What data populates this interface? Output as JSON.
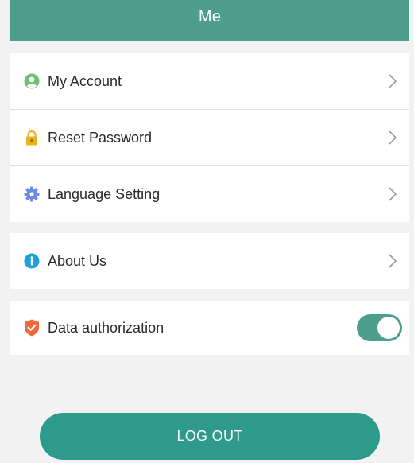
{
  "header": {
    "title": "Me"
  },
  "menu": {
    "account": {
      "label": "My Account",
      "icon": "user-icon"
    },
    "reset_password": {
      "label": "Reset Password",
      "icon": "lock-icon"
    },
    "language": {
      "label": "Language Setting",
      "icon": "gear-icon"
    },
    "about": {
      "label": "About Us",
      "icon": "info-icon"
    },
    "data_authorization": {
      "label": "Data authorization",
      "icon": "shield-icon",
      "enabled": true
    }
  },
  "logout": {
    "label": "LOG OUT"
  },
  "colors": {
    "header": "#4e9e8e",
    "toggle_on": "#4e9e8e",
    "logout_button": "#2e9a8b",
    "account_icon": "#6cc26d",
    "lock_icon": "#e8b41e",
    "gear_icon": "#6d8ce8",
    "info_icon": "#1ea0d8",
    "shield_icon": "#f2683a"
  }
}
